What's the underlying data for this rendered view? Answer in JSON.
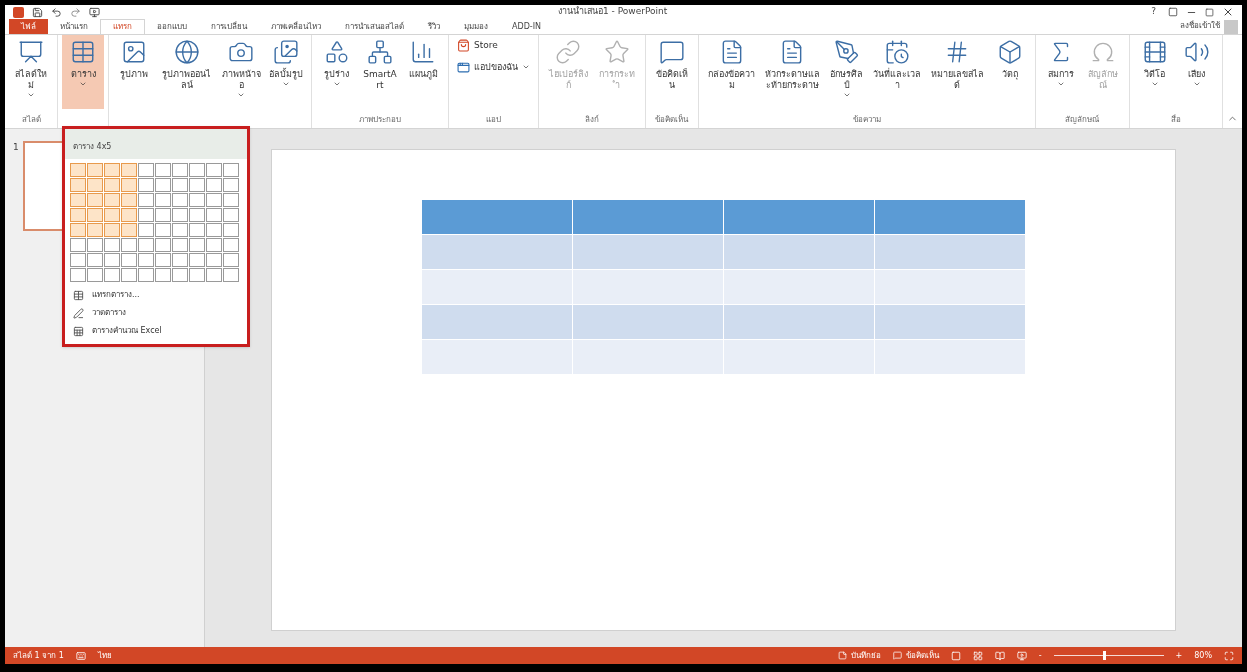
{
  "window": {
    "title": "งานนำเสนอ1 - PowerPoint",
    "sign_in": "ลงชื่อเข้าใช้",
    "help": "?"
  },
  "tabs": [
    {
      "label": "ไฟล์",
      "kind": "file",
      "selected": false
    },
    {
      "label": "หน้าแรก",
      "kind": "tab",
      "selected": false
    },
    {
      "label": "แทรก",
      "kind": "tab",
      "selected": true
    },
    {
      "label": "ออกแบบ",
      "kind": "tab",
      "selected": false
    },
    {
      "label": "การเปลี่ยน",
      "kind": "tab",
      "selected": false
    },
    {
      "label": "ภาพเคลื่อนไหว",
      "kind": "tab",
      "selected": false
    },
    {
      "label": "การนำเสนอสไลด์",
      "kind": "tab",
      "selected": false
    },
    {
      "label": "รีวิว",
      "kind": "tab",
      "selected": false
    },
    {
      "label": "มุมมอง",
      "kind": "tab",
      "selected": false
    },
    {
      "label": "ADD-IN",
      "kind": "tab",
      "selected": false
    }
  ],
  "ribbon": {
    "groups": [
      {
        "label": "สไลด์",
        "items": [
          {
            "label": "สไลด์ใหม่",
            "kind": "large",
            "selected": false,
            "disabled": false,
            "has_menu": true
          }
        ]
      },
      {
        "items": [
          {
            "label": "ตาราง",
            "kind": "large",
            "selected": true,
            "disabled": false,
            "has_menu": true
          }
        ]
      },
      {
        "items": [
          {
            "label": "รูปภาพ",
            "kind": "large",
            "selected": false,
            "disabled": false,
            "has_menu": false
          },
          {
            "label": "รูปภาพออนไลน์",
            "kind": "large",
            "selected": false,
            "disabled": false,
            "has_menu": false
          },
          {
            "label": "ภาพหน้าจอ",
            "kind": "large",
            "selected": false,
            "disabled": false,
            "has_menu": true
          },
          {
            "label": "อัลบั้มรูป",
            "kind": "large",
            "selected": false,
            "disabled": false,
            "has_menu": true
          }
        ]
      },
      {
        "label": "ภาพประกอบ",
        "items": [
          {
            "label": "รูปร่าง",
            "kind": "large",
            "selected": false,
            "disabled": false,
            "has_menu": true
          },
          {
            "label": "SmartArt",
            "kind": "large",
            "selected": false,
            "disabled": false,
            "has_menu": false
          },
          {
            "label": "แผนภูมิ",
            "kind": "large",
            "selected": false,
            "disabled": false,
            "has_menu": false
          }
        ]
      },
      {
        "label": "แอป",
        "items": [
          {
            "label": "Store",
            "kind": "small",
            "selected": false,
            "disabled": false,
            "has_menu": false
          },
          {
            "label": "แอปของฉัน",
            "kind": "small",
            "selected": false,
            "disabled": false,
            "has_menu": true
          }
        ]
      },
      {
        "label": "ลิงก์",
        "items": [
          {
            "label": "ไฮเปอร์ลิงก์",
            "kind": "large",
            "selected": false,
            "disabled": true,
            "has_menu": false
          },
          {
            "label": "การกระทำ",
            "kind": "large",
            "selected": false,
            "disabled": true,
            "has_menu": false
          }
        ]
      },
      {
        "label": "ข้อคิดเห็น",
        "items": [
          {
            "label": "ข้อคิดเห็น",
            "kind": "large",
            "selected": false,
            "disabled": false,
            "has_menu": false
          }
        ]
      },
      {
        "label": "ข้อความ",
        "items": [
          {
            "label": "กล่องข้อความ",
            "kind": "large",
            "selected": false,
            "disabled": false,
            "has_menu": false
          },
          {
            "label": "หัวกระดาษและท้ายกระดาษ",
            "kind": "large",
            "selected": false,
            "disabled": false,
            "has_menu": false
          },
          {
            "label": "อักษรศิลป์",
            "kind": "large",
            "selected": false,
            "disabled": false,
            "has_menu": true
          },
          {
            "label": "วันที่และเวลา",
            "kind": "large",
            "selected": false,
            "disabled": false,
            "has_menu": false
          },
          {
            "label": "หมายเลขสไลด์",
            "kind": "large",
            "selected": false,
            "disabled": false,
            "has_menu": false
          },
          {
            "label": "วัตถุ",
            "kind": "large",
            "selected": false,
            "disabled": false,
            "has_menu": false
          }
        ]
      },
      {
        "label": "สัญลักษณ์",
        "items": [
          {
            "label": "สมการ",
            "kind": "large",
            "selected": false,
            "disabled": false,
            "has_menu": true
          },
          {
            "label": "สัญลักษณ์",
            "kind": "large",
            "selected": false,
            "disabled": true,
            "has_menu": false
          }
        ]
      },
      {
        "label": "สื่อ",
        "items": [
          {
            "label": "วิดีโอ",
            "kind": "large",
            "selected": false,
            "disabled": false,
            "has_menu": true
          },
          {
            "label": "เสียง",
            "kind": "large",
            "selected": false,
            "disabled": false,
            "has_menu": true
          }
        ]
      }
    ]
  },
  "thumbnails": [
    {
      "number": "1",
      "selected": true
    }
  ],
  "table_menu": {
    "title": "ตาราง 4x5",
    "grid_rows": [
      {
        "cells": [
          {
            "selected": true
          },
          {
            "selected": true
          },
          {
            "selected": true
          },
          {
            "selected": true
          },
          {
            "selected": false
          },
          {
            "selected": false
          },
          {
            "selected": false
          },
          {
            "selected": false
          },
          {
            "selected": false
          },
          {
            "selected": false
          }
        ]
      },
      {
        "cells": [
          {
            "selected": true
          },
          {
            "selected": true
          },
          {
            "selected": true
          },
          {
            "selected": true
          },
          {
            "selected": false
          },
          {
            "selected": false
          },
          {
            "selected": false
          },
          {
            "selected": false
          },
          {
            "selected": false
          },
          {
            "selected": false
          }
        ]
      },
      {
        "cells": [
          {
            "selected": true
          },
          {
            "selected": true
          },
          {
            "selected": true
          },
          {
            "selected": true
          },
          {
            "selected": false
          },
          {
            "selected": false
          },
          {
            "selected": false
          },
          {
            "selected": false
          },
          {
            "selected": false
          },
          {
            "selected": false
          }
        ]
      },
      {
        "cells": [
          {
            "selected": true
          },
          {
            "selected": true
          },
          {
            "selected": true
          },
          {
            "selected": true
          },
          {
            "selected": false
          },
          {
            "selected": false
          },
          {
            "selected": false
          },
          {
            "selected": false
          },
          {
            "selected": false
          },
          {
            "selected": false
          }
        ]
      },
      {
        "cells": [
          {
            "selected": true
          },
          {
            "selected": true
          },
          {
            "selected": true
          },
          {
            "selected": true
          },
          {
            "selected": false
          },
          {
            "selected": false
          },
          {
            "selected": false
          },
          {
            "selected": false
          },
          {
            "selected": false
          },
          {
            "selected": false
          }
        ]
      },
      {
        "cells": [
          {
            "selected": false
          },
          {
            "selected": false
          },
          {
            "selected": false
          },
          {
            "selected": false
          },
          {
            "selected": false
          },
          {
            "selected": false
          },
          {
            "selected": false
          },
          {
            "selected": false
          },
          {
            "selected": false
          },
          {
            "selected": false
          }
        ]
      },
      {
        "cells": [
          {
            "selected": false
          },
          {
            "selected": false
          },
          {
            "selected": false
          },
          {
            "selected": false
          },
          {
            "selected": false
          },
          {
            "selected": false
          },
          {
            "selected": false
          },
          {
            "selected": false
          },
          {
            "selected": false
          },
          {
            "selected": false
          }
        ]
      },
      {
        "cells": [
          {
            "selected": false
          },
          {
            "selected": false
          },
          {
            "selected": false
          },
          {
            "selected": false
          },
          {
            "selected": false
          },
          {
            "selected": false
          },
          {
            "selected": false
          },
          {
            "selected": false
          },
          {
            "selected": false
          },
          {
            "selected": false
          }
        ]
      }
    ],
    "items": [
      "แทรกตาราง...",
      "วาดตาราง",
      "ตารางคำนวณ Excel"
    ]
  },
  "slide": {
    "table_rows": [
      {
        "kind": "header"
      },
      {
        "kind": "band"
      },
      {
        "kind": "plain"
      },
      {
        "kind": "band"
      },
      {
        "kind": "plain"
      }
    ]
  },
  "status_bar": {
    "slide_info": "สไลด์ 1 จาก 1",
    "language": "ไทย",
    "notes": "บันทึกย่อ",
    "comments": "ข้อคิดเห็น",
    "zoom": {
      "level": 0.45,
      "reading": "80%",
      "zoom_out": "-",
      "zoom_in": "+"
    }
  }
}
